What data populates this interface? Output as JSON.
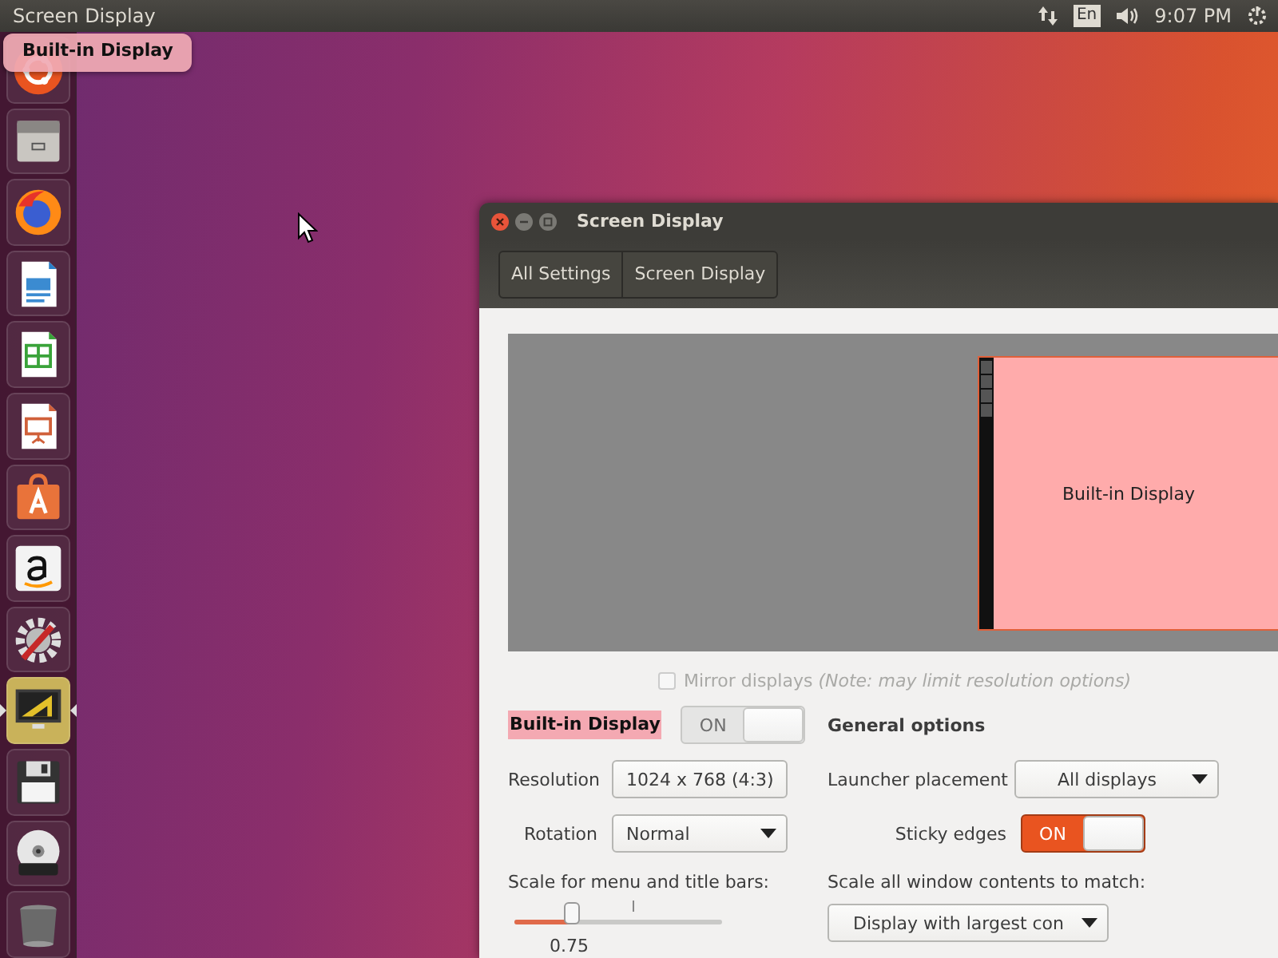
{
  "top_panel": {
    "window_title": "Screen Display",
    "keyboard_layout": "En",
    "clock": "9:07 PM"
  },
  "tooltip": {
    "text": "Built-in Display"
  },
  "launcher": {
    "items": [
      {
        "kind": "ubuntu",
        "selected": false
      },
      {
        "kind": "files",
        "selected": false
      },
      {
        "kind": "firefox",
        "selected": false
      },
      {
        "kind": "writer",
        "selected": false
      },
      {
        "kind": "calc",
        "selected": false
      },
      {
        "kind": "impress",
        "selected": false
      },
      {
        "kind": "software",
        "selected": false
      },
      {
        "kind": "amazon",
        "selected": false
      },
      {
        "kind": "settings",
        "selected": false
      },
      {
        "kind": "display",
        "selected": true
      },
      {
        "kind": "floppy",
        "selected": false
      },
      {
        "kind": "dvd",
        "selected": false
      },
      {
        "kind": "trash",
        "selected": false
      }
    ]
  },
  "window": {
    "title": "Screen Display",
    "breadcrumbs": [
      "All Settings",
      "Screen Display"
    ],
    "preview": {
      "monitor_label": "Built-in Display"
    },
    "mirror": {
      "label": "Mirror displays *(Note: may limit resolution options)*",
      "checked": false,
      "disabled": true
    },
    "display": {
      "name": "Built-in Display",
      "switch": {
        "label": "ON",
        "on": true,
        "disabled": true
      },
      "resolution": {
        "label": "Resolution",
        "value": "1024 x 768 (4:3)"
      },
      "rotation": {
        "label": "Rotation",
        "value": "Normal"
      },
      "scale": {
        "label": "Scale for menu and title bars:",
        "level": 0.28,
        "value": "0.75"
      }
    },
    "general": {
      "heading": "General options",
      "launcher_placement": {
        "label": "Launcher placement",
        "value": "All displays"
      },
      "sticky_edges": {
        "label": "Sticky edges",
        "switch": {
          "label": "ON",
          "on": true,
          "disabled": false
        }
      },
      "scale_all": {
        "label": "Scale all window contents to match:",
        "value": "Display with largest con"
      }
    }
  }
}
